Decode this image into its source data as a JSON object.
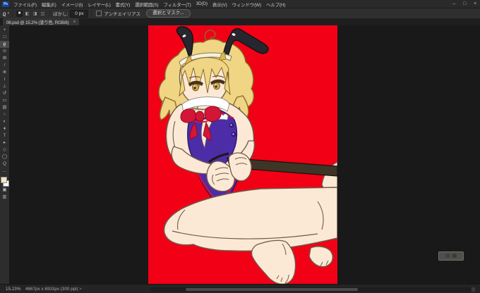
{
  "app": {
    "logo_text": "Ps"
  },
  "menu_bar": {
    "items": [
      "ファイル(F)",
      "編集(E)",
      "イメージ(I)",
      "レイヤー(L)",
      "書式(Y)",
      "選択範囲(S)",
      "フィルター(T)",
      "3D(D)",
      "表示(V)",
      "ウィンドウ(W)",
      "ヘルプ(H)"
    ]
  },
  "window_controls": {
    "minimize": "–",
    "maximize": "□",
    "close": "×"
  },
  "options_bar": {
    "tool_glyph": "ϱ",
    "tool_caret": "▾",
    "selection_modes": [
      {
        "name": "new-selection",
        "glyph": "■"
      },
      {
        "name": "add-to-selection",
        "glyph": "◧"
      },
      {
        "name": "subtract-from-selection",
        "glyph": "◨"
      },
      {
        "name": "intersect-selection",
        "glyph": "◫"
      }
    ],
    "feather_label": "ぼかし:",
    "feather_value": "0 px",
    "antialias_label": "アンチエイリアス",
    "select_and_mask_label": "選択とマスク..."
  },
  "document_tab": {
    "title": "08.psd @ 15.2% (塗り色, RGB/8)",
    "close_glyph": "×"
  },
  "toolbar": {
    "tools": [
      {
        "name": "move-tool",
        "glyph": "+"
      },
      {
        "name": "marquee-tool",
        "glyph": "□"
      },
      {
        "name": "lasso-tool",
        "glyph": "ϱ"
      },
      {
        "name": "object-selection-tool",
        "glyph": "⊙"
      },
      {
        "name": "crop-tool",
        "glyph": "⊞"
      },
      {
        "name": "eyedropper-tool",
        "glyph": "/"
      },
      {
        "name": "spot-healing-tool",
        "glyph": "⊕"
      },
      {
        "name": "brush-tool",
        "glyph": "≀"
      },
      {
        "name": "clone-stamp-tool",
        "glyph": "⊥"
      },
      {
        "name": "history-brush-tool",
        "glyph": "↺"
      },
      {
        "name": "eraser-tool",
        "glyph": "▭"
      },
      {
        "name": "gradient-tool",
        "glyph": "▤"
      },
      {
        "name": "blur-tool",
        "glyph": "○"
      },
      {
        "name": "dodge-tool",
        "glyph": "◐"
      },
      {
        "name": "pen-tool",
        "glyph": "♦"
      },
      {
        "name": "type-tool",
        "glyph": "T"
      },
      {
        "name": "path-selection-tool",
        "glyph": "▸"
      },
      {
        "name": "shape-tool",
        "glyph": "◇"
      },
      {
        "name": "hand-tool",
        "glyph": "◯"
      },
      {
        "name": "zoom-tool",
        "glyph": "Q"
      },
      {
        "name": "edit-toolbar",
        "glyph": "…"
      }
    ],
    "extras": [
      {
        "name": "quick-mask",
        "glyph": "▣"
      },
      {
        "name": "screen-mode",
        "glyph": "▥"
      }
    ]
  },
  "status_bar": {
    "zoom_value": "15.23%",
    "document_info": "4667px x 6933px (300 ppi)",
    "chevron": ">"
  },
  "floating_pill": {
    "glyph_a": "▤",
    "glyph_b": "▦"
  },
  "colors": {
    "ui": {
      "bar": "#2a2a2a",
      "pasteboard": "#191919",
      "tab_active": "#343434",
      "selected_tool_bg": "#4a4a4a",
      "scrollbar_thumb": "#4b4b4b",
      "logo_blue": "#10479c"
    },
    "swatches": {
      "foreground": "#efe7bf",
      "background": "#ffffff"
    },
    "artwork": {
      "background_red": "#f20016",
      "skin": "#fbe9d6",
      "skin_line": "#6e5b49",
      "hair": "#efd584",
      "hair_line": "#8a6a2a",
      "ears_black": "#26262e",
      "headband_cream": "#f6f0dd",
      "prong_gold": "#d8b94e",
      "eye_gold": "#cfa94d",
      "collar_white": "#ffffff",
      "bow_red": "#d41537",
      "bow_line": "#8c0c22",
      "leotard_purple": "#4d2ca8",
      "leotard_line": "#251260",
      "trim_red": "#d41537",
      "pole_brown": "#3e3527"
    }
  }
}
